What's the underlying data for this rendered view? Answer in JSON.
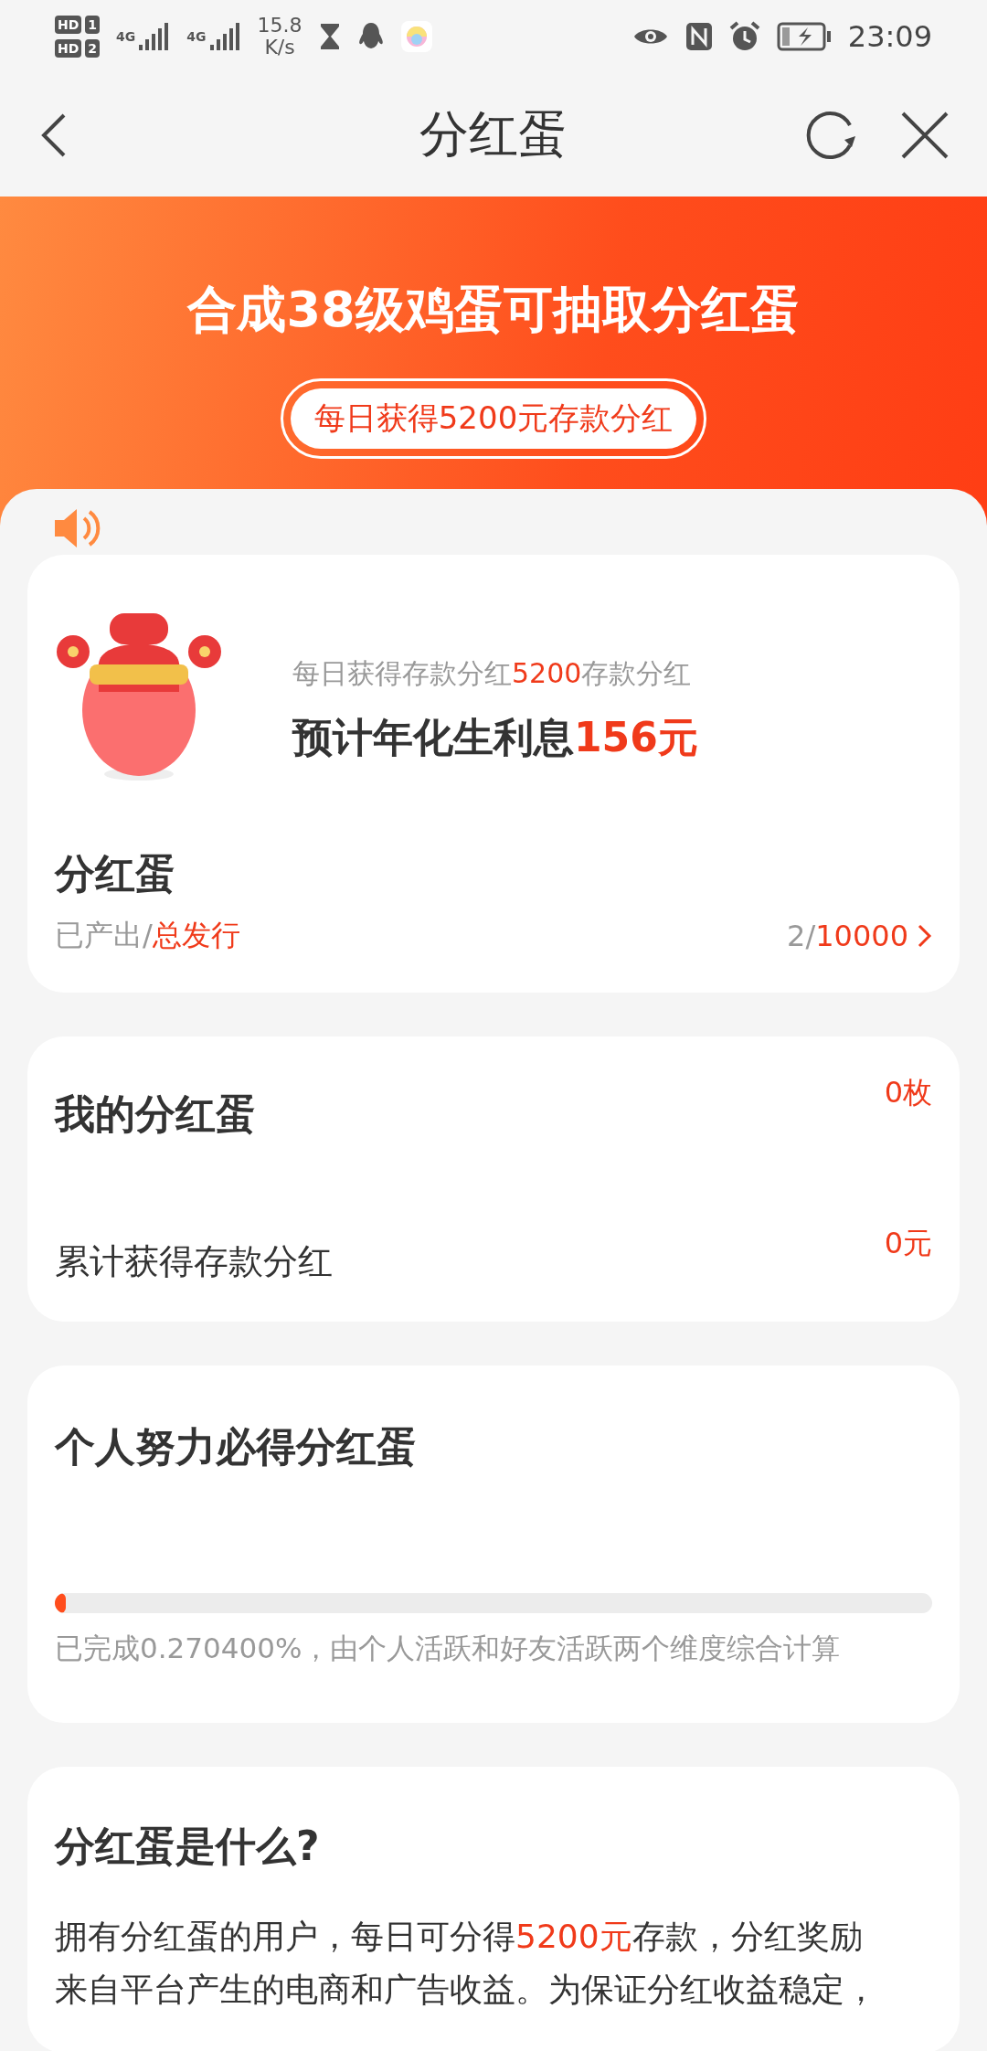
{
  "status_bar": {
    "sims": [
      {
        "hd": "HD",
        "slot": "1",
        "network": "4G"
      },
      {
        "hd": "HD",
        "slot": "2",
        "network": "4G"
      }
    ],
    "net_speed": [
      "15.8",
      "K/s"
    ],
    "time": "23:09"
  },
  "nav": {
    "title": "分红蛋"
  },
  "banner": {
    "headline": "合成38级鸡蛋可抽取分红蛋",
    "pill": "每日获得5200元存款分红"
  },
  "egg_card": {
    "subtitle": {
      "prefix": "每日获得存款分红",
      "highlight": "5200",
      "suffix": "存款分红"
    },
    "interest": {
      "prefix": "预计年化生利息",
      "highlight": "156元"
    },
    "title": "分红蛋",
    "stats_label": {
      "prefix": "已产出/",
      "highlight": "总发行"
    },
    "stats_value": {
      "prefix": "2/",
      "highlight": "10000"
    }
  },
  "my_card": {
    "rows": [
      {
        "label": "我的分红蛋",
        "value": "0枚",
        "kind": "title"
      },
      {
        "label": "累计获得存款分红",
        "value": "0元",
        "kind": "plain"
      }
    ]
  },
  "effort_card": {
    "title": "个人努力必得分红蛋",
    "level": 0.0027,
    "note": "已完成0.270400%，由个人活跃和好友活跃两个维度综合计算"
  },
  "about_card": {
    "title": "分红蛋是什么?",
    "lines": [
      {
        "prefix": "拥有分红蛋的用户，每日可分得",
        "highlight": "5200元",
        "suffix": "存款，分红奖励"
      },
      {
        "prefix": "来自平台产生的电商和广告收益。为保证分红收益稳定，"
      }
    ]
  }
}
